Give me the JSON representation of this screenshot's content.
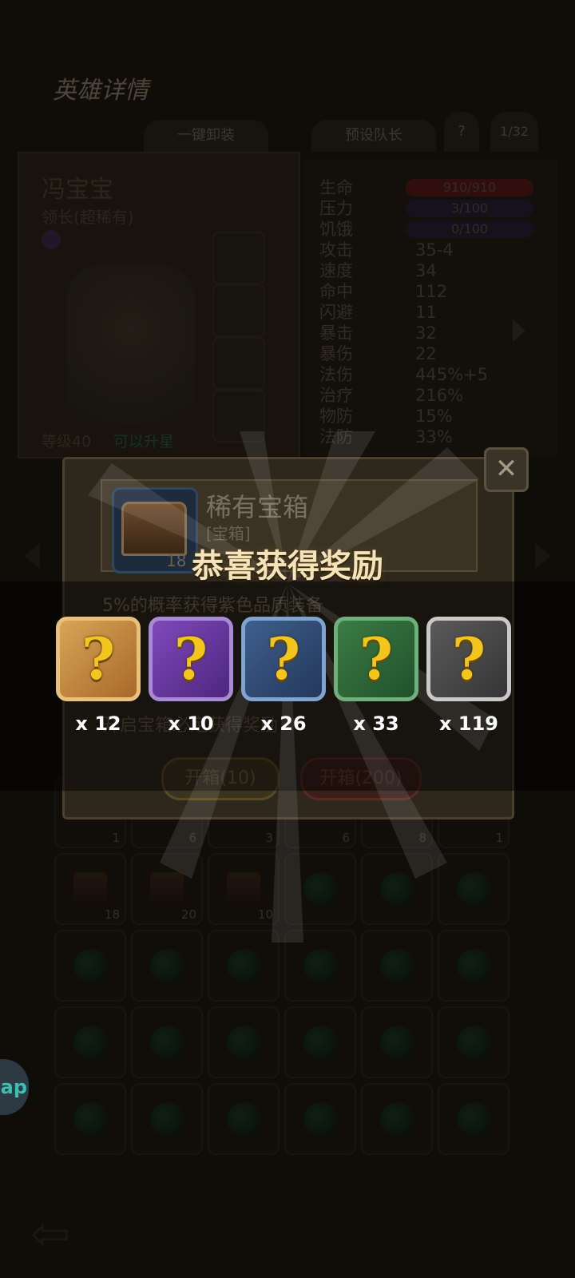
{
  "header": {
    "title": "英雄详情"
  },
  "tabs": {
    "unequip": "一键卸装",
    "captain": "预设队长",
    "help": "?",
    "page": "1/32"
  },
  "hero": {
    "name": "冯宝宝",
    "title": "领长(超稀有)",
    "level": "等级40",
    "status": "可以升星"
  },
  "stats": [
    {
      "label": "生命",
      "value": "910/910"
    },
    {
      "label": "压力",
      "value": "3/100"
    },
    {
      "label": "饥饿",
      "value": "0/100"
    },
    {
      "label": "攻击",
      "value": "35-4"
    },
    {
      "label": "速度",
      "value": "34"
    },
    {
      "label": "命中",
      "value": "112"
    },
    {
      "label": "闪避",
      "value": "11"
    },
    {
      "label": "暴击",
      "value": "32"
    },
    {
      "label": "暴伤",
      "value": "22"
    },
    {
      "label": "法伤",
      "value": "445%+5"
    },
    {
      "label": "治疗",
      "value": "216%"
    },
    {
      "label": "物防",
      "value": "15%"
    },
    {
      "label": "法防",
      "value": "33%"
    }
  ],
  "dialog": {
    "item_name": "稀有宝箱",
    "item_type": "[宝箱]",
    "item_count": "18",
    "description": "5%的概率获得紫色品质装备",
    "description2": "开启宝箱必定获得奖励",
    "open_10": "开箱(10)",
    "open_200": "开箱(200)"
  },
  "reward": {
    "title": "恭喜获得奖励",
    "items": [
      {
        "rarity": "legendary",
        "qty": "x 12"
      },
      {
        "rarity": "epic",
        "qty": "x 10"
      },
      {
        "rarity": "rare",
        "qty": "x 26"
      },
      {
        "rarity": "uncommon",
        "qty": "x 33"
      },
      {
        "rarity": "common",
        "qty": "x 119"
      }
    ]
  },
  "inventory": {
    "row1_counts": [
      "1",
      "6",
      "3",
      "6",
      "8",
      "1"
    ],
    "row2_counts": [
      "18",
      "20",
      "10",
      "",
      "",
      ""
    ]
  },
  "app_bubble": "ap",
  "colors": {
    "legendary": "#c8862e",
    "epic": "#6a3a9a",
    "rare": "#2f4d78",
    "uncommon": "#2f6a3a",
    "common": "#4a4a4a",
    "title_text": "#f6e3b8",
    "qmark": "#f4c51c"
  }
}
